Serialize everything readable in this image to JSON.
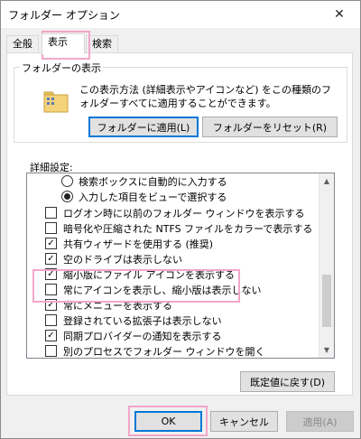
{
  "window": {
    "title": "フォルダー オプション",
    "close_glyph": "✕"
  },
  "tabs": [
    {
      "label": "全般"
    },
    {
      "label": "表示",
      "active": true
    },
    {
      "label": "検索"
    }
  ],
  "folder_view": {
    "legend": "フォルダーの表示",
    "description": "この表示方法 (詳細表示やアイコンなど) をこの種類のフォルダーすべてに適用することができます。",
    "apply_button": "フォルダーに適用(L)",
    "reset_button": "フォルダーをリセット(R)"
  },
  "advanced": {
    "label": "詳細設定:",
    "items": [
      {
        "type": "radio",
        "checked": false,
        "label": "検索ボックスに自動的に入力する"
      },
      {
        "type": "radio",
        "checked": true,
        "label": "入力した項目をビューで選択する"
      },
      {
        "type": "checkbox",
        "checked": false,
        "label": "ログオン時に以前のフォルダー ウィンドウを表示する"
      },
      {
        "type": "checkbox",
        "checked": false,
        "label": "暗号化や圧縮された NTFS ファイルをカラーで表示する"
      },
      {
        "type": "checkbox",
        "checked": true,
        "label": "共有ウィザードを使用する (推奨)"
      },
      {
        "type": "checkbox",
        "checked": true,
        "label": "空のドライブは表示しない"
      },
      {
        "type": "checkbox",
        "checked": true,
        "label": "縮小版にファイル アイコンを表示する"
      },
      {
        "type": "checkbox",
        "checked": false,
        "label": "常にアイコンを表示し、縮小版は表示しない"
      },
      {
        "type": "checkbox",
        "checked": true,
        "label": "常にメニューを表示する"
      },
      {
        "type": "checkbox",
        "checked": false,
        "label": "登録されている拡張子は表示しない"
      },
      {
        "type": "checkbox",
        "checked": true,
        "label": "同期プロバイダーの通知を表示する"
      },
      {
        "type": "checkbox",
        "checked": false,
        "label": "別のプロセスでフォルダー ウィンドウを開く"
      }
    ]
  },
  "restore_defaults_button": "既定値に戻す(D)",
  "footer": {
    "ok": "OK",
    "cancel": "キャンセル",
    "apply": "適用(A)"
  },
  "colors": {
    "highlight": "#f4a6c9",
    "default_button_border": "#0078d7"
  }
}
